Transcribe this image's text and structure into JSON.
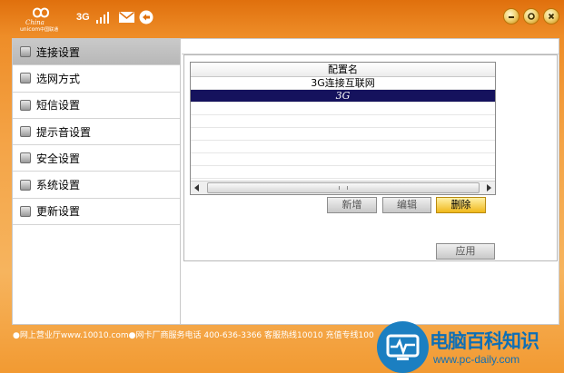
{
  "titlebar": {
    "logo_text_1": "China",
    "logo_text_2": "unicom",
    "logo_text_cn": "中国联通",
    "network_type": "3G"
  },
  "sidebar": {
    "items": [
      {
        "label": "连接设置",
        "active": true
      },
      {
        "label": "选网方式",
        "active": false
      },
      {
        "label": "短信设置",
        "active": false
      },
      {
        "label": "提示音设置",
        "active": false
      },
      {
        "label": "安全设置",
        "active": false
      },
      {
        "label": "系统设置",
        "active": false
      },
      {
        "label": "更新设置",
        "active": false
      }
    ]
  },
  "profile_list": {
    "column_header": "配置名",
    "rows": [
      {
        "name": "3G连接互联网",
        "selected": false
      },
      {
        "name": "3G",
        "selected": true
      }
    ]
  },
  "buttons": {
    "add": "新增",
    "edit": "编辑",
    "delete": "删除",
    "apply": "应用"
  },
  "footer": {
    "text": "●网上营业厅www.10010.com●网卡厂商服务电话 400-636-3366  客服热线10010  充值专线100"
  },
  "watermark": {
    "title": "电脑百科知识",
    "url": "www.pc-daily.com"
  },
  "colors": {
    "frame_orange": "#ee8d28",
    "selected_row": "#15125d",
    "primary_button": "#f0b81a",
    "watermark_blue": "#0f6fb5"
  }
}
